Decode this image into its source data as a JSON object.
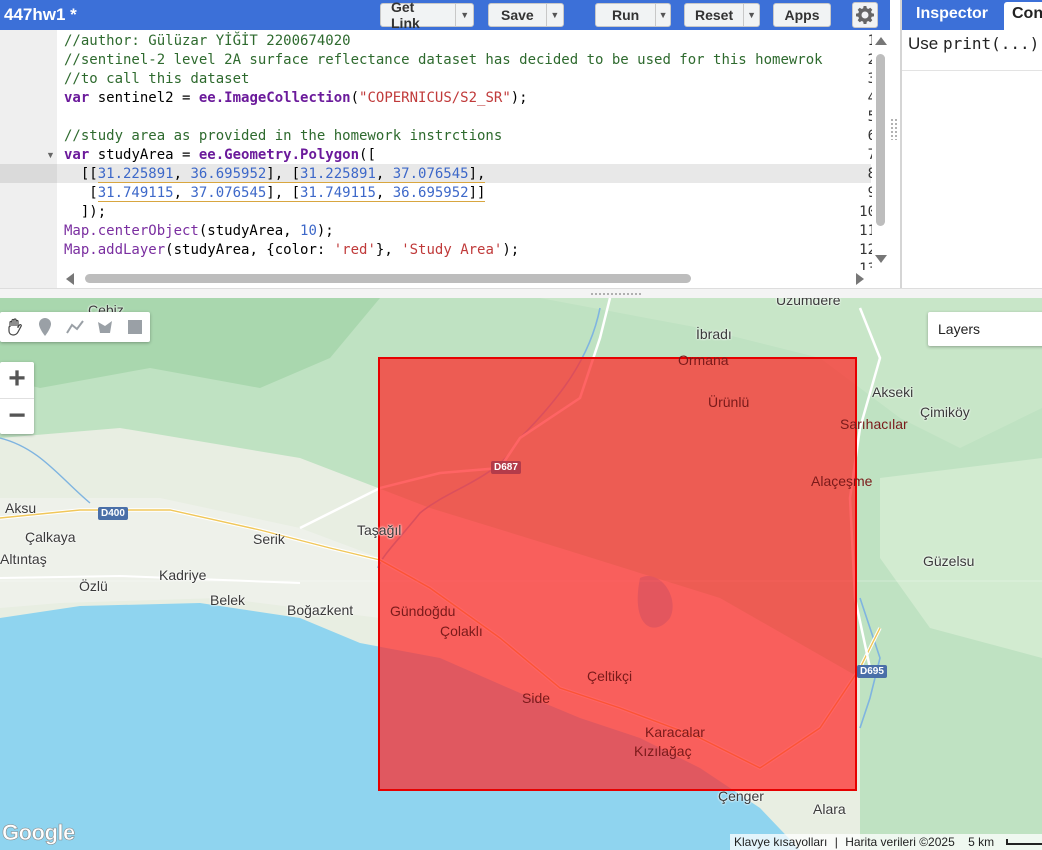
{
  "toolbar": {
    "script_name": "447hw1 *",
    "get_link_label": "Get Link",
    "save_label": "Save",
    "run_label": "Run",
    "reset_label": "Reset",
    "apps_label": "Apps",
    "settings_icon": "gear-icon",
    "dropdown_icon": "chevron-down-icon",
    "accent_color": "#3c70d8"
  },
  "right_panel": {
    "tabs": [
      "Inspector",
      "Console"
    ],
    "console_hint_prefix": "Use ",
    "console_hint_code": "print(...)",
    "console_hint_suffix": " t"
  },
  "editor": {
    "line_numbers": [
      "1",
      "2",
      "3",
      "4",
      "5",
      "6",
      "7",
      "8",
      "9",
      "10",
      "11",
      "12",
      "13"
    ],
    "active_line": 8,
    "lines": {
      "l1": "//author: Gülüzar YİĞİT 2200674020",
      "l2": "//sentinel-2 level 2A surface reflectance dataset has decided to be used for this homewrok",
      "l3": "//to call this dataset",
      "l4": {
        "kw": "var",
        "name": " sentinel2 = ",
        "obj": "ee.ImageCollection",
        "open": "(",
        "str": "\"COPERNICUS/S2_SR\"",
        "close": ");"
      },
      "l6": "//study area as provided in the homework instrctions",
      "l7": {
        "kw": "var",
        "name": " studyArea = ",
        "obj": "ee.Geometry.Polygon",
        "open": "(["
      },
      "l8": {
        "indent": "  [[",
        "a": "31.225891",
        "sep1": ", ",
        "b": "36.695952",
        "mid": "], [",
        "c": "31.225891",
        "sep2": ", ",
        "d": "37.076545",
        "end": "],"
      },
      "l9": {
        "indent": "   [",
        "a": "31.749115",
        "sep1": ", ",
        "b": "37.076545",
        "mid": "], [",
        "c": "31.749115",
        "sep2": ", ",
        "d": "36.695952",
        "end": "]]"
      },
      "l10": "  ]);",
      "l11": {
        "fn": "Map.centerObject",
        "args": "(studyArea, ",
        "num": "10",
        "end": ");"
      },
      "l12": {
        "fn": "Map.addLayer",
        "args": "(studyArea, {color: ",
        "str1": "'red'",
        "mid": "}, ",
        "str2": "'Study Area'",
        "end": ");"
      }
    }
  },
  "map": {
    "layers_label": "Layers",
    "study_area_color": "#ff2828",
    "places": [
      "Cebiz",
      "Üzümdere",
      "İbradı",
      "Ormana",
      "Ürünlü",
      "Akseki",
      "Çimiköy",
      "Sarıhacılar",
      "Alaçeşme",
      "Aksu",
      "Çalkaya",
      "Altıntaş",
      "Serik",
      "Taşağıl",
      "Güzelsu",
      "Özlü",
      "Kadriye",
      "Belek",
      "Boğazkent",
      "Gündoğdu",
      "Çolaklı",
      "Çeltikçi",
      "Side",
      "Karacalar",
      "Kızılağaç",
      "Çenger",
      "Alara"
    ],
    "roads": {
      "d687": "D687",
      "d400": "D400",
      "d695": "D695"
    },
    "draw_tools": [
      "hand-icon",
      "marker-icon",
      "polyline-icon",
      "polygon-icon",
      "rectangle-icon"
    ],
    "zoom_in": "+",
    "zoom_out": "−",
    "logo_text": "Google",
    "attribution": {
      "shortcuts": "Klavye kısayolları",
      "sep": "|",
      "data": "Harita verileri ©2025",
      "scale": "5 km"
    }
  }
}
